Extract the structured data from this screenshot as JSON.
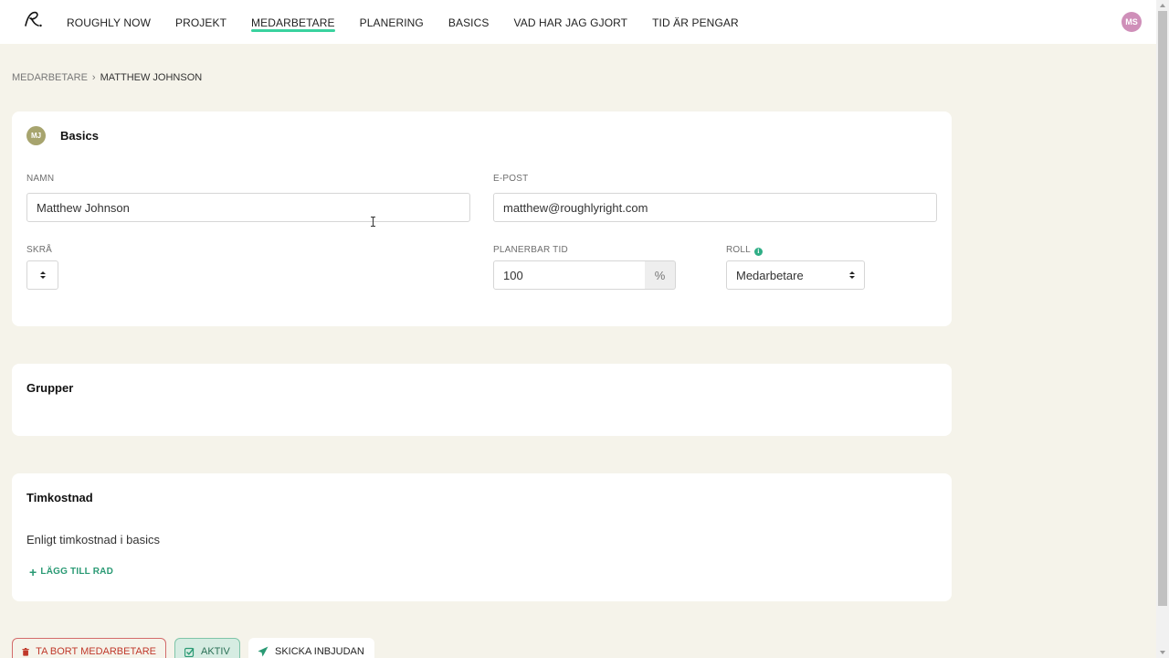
{
  "nav": {
    "items": [
      {
        "label": "ROUGHLY NOW",
        "active": false
      },
      {
        "label": "PROJEKT",
        "active": false
      },
      {
        "label": "MEDARBETARE",
        "active": true
      },
      {
        "label": "PLANERING",
        "active": false
      },
      {
        "label": "BASICS",
        "active": false
      },
      {
        "label": "VAD HAR JAG GJORT",
        "active": false
      },
      {
        "label": "TID ÄR PENGAR",
        "active": false
      }
    ],
    "user_initials": "MS"
  },
  "breadcrumb": {
    "parent": "MEDARBETARE",
    "separator": "›",
    "current": "MATTHEW JOHNSON"
  },
  "basics": {
    "badge": "MJ",
    "title": "Basics",
    "name_label": "NAMN",
    "name_value": "Matthew Johnson",
    "email_label": "E-POST",
    "email_value": "matthew@roughlyright.com",
    "skra_label": "SKRÅ",
    "planerbar_label": "PLANERBAR TID",
    "planerbar_value": "100",
    "planerbar_unit": "%",
    "roll_label": "ROLL",
    "roll_value": "Medarbetare"
  },
  "groups": {
    "title": "Grupper"
  },
  "cost": {
    "title": "Timkostnad",
    "text": "Enligt timkostnad i basics",
    "add_row": "LÄGG TILL RAD"
  },
  "actions": {
    "delete": "TA BORT MEDARBETARE",
    "active": "AKTIV",
    "invite": "SKICKA INBJUDAN"
  },
  "colors": {
    "accent": "#3ad29f",
    "danger": "#c0392b",
    "background": "#f5f3ea"
  }
}
